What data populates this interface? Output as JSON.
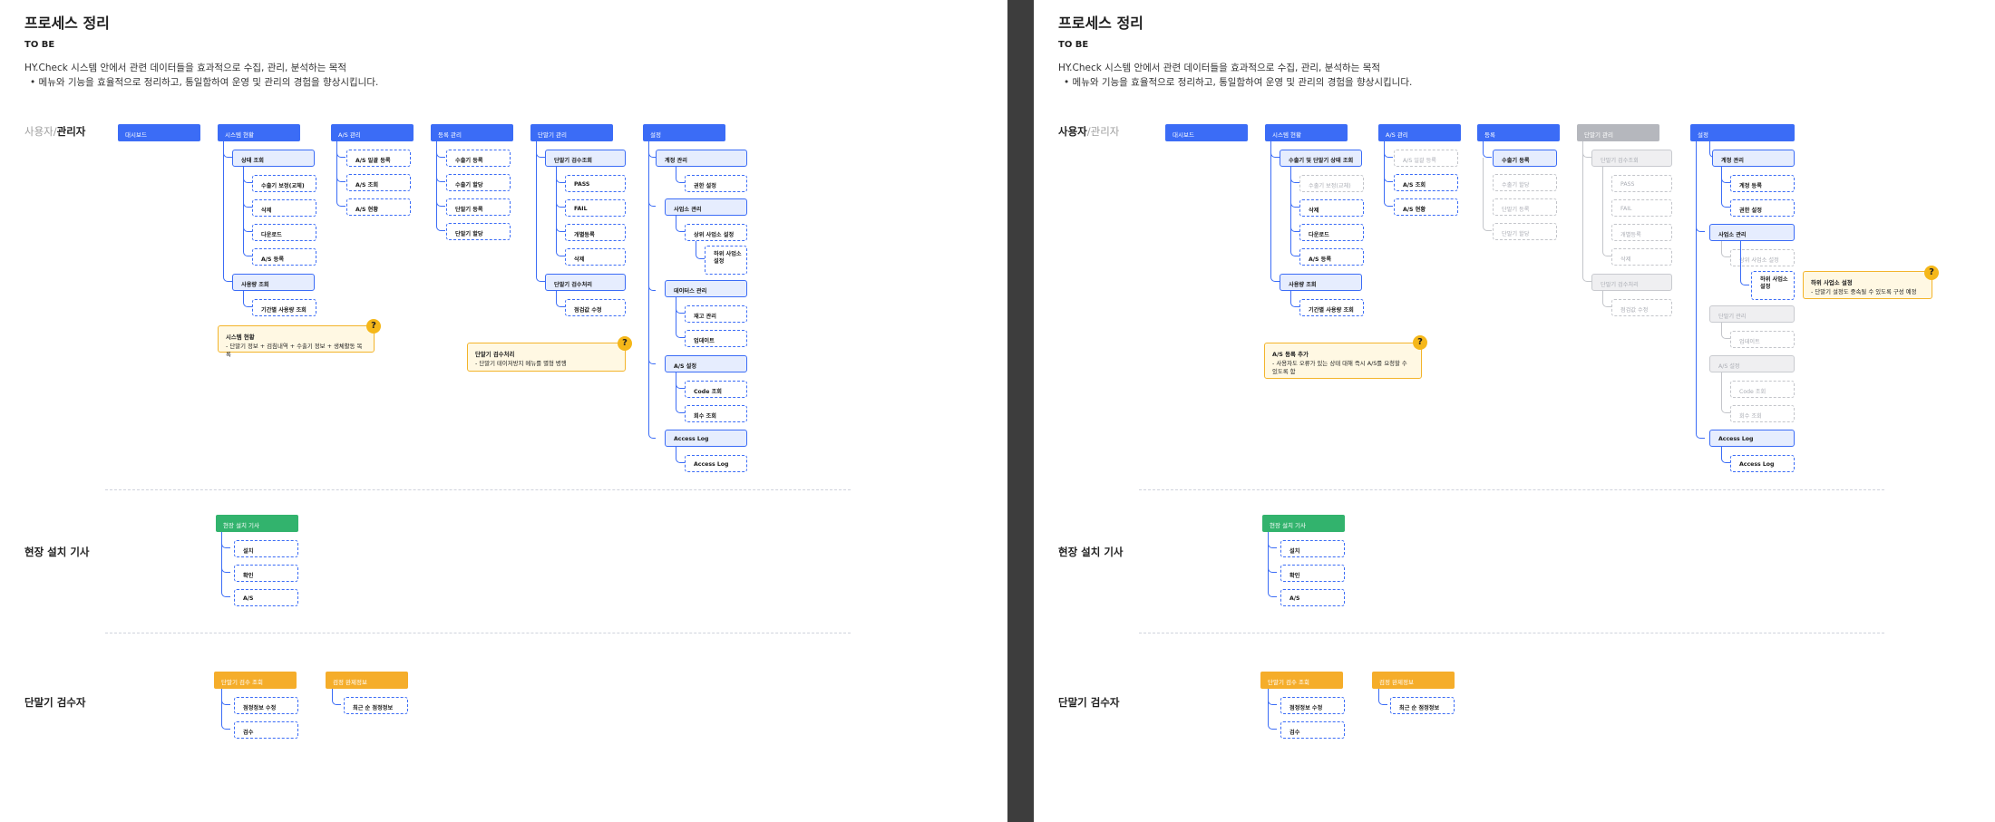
{
  "header": {
    "title": "프로세스 정리",
    "subtitle": "TO BE",
    "description": "HY.Check 시스템 안에서 관련 데이터들을 효과적으로 수집, 관리, 분석하는 목적",
    "bullet": "•  메뉴와 기능을 효율적으로 정리하고, 통일함하여 운영 및 관리의 경험을 향상시킵니다."
  },
  "left": {
    "sec1_a": "사용자/",
    "sec1_b": "관리자",
    "sec2": "현장 설치 기사",
    "sec3": "단말기 검수자",
    "roots": [
      "대시보드",
      "시스템 현황",
      "A/S 관리",
      "등록 관리",
      "단말기 관리",
      "설정"
    ],
    "sys": [
      "상태 조회",
      "수출기 보정(교체)",
      "삭제",
      "다운로드",
      "A/S 등록",
      "사용량 조회",
      "기간별 사용량 조회"
    ],
    "as": [
      "A/S 일괄 등록",
      "A/S 조회",
      "A/S 현황"
    ],
    "reg": [
      "수출기 등록",
      "수출기 할당",
      "단말기 등록",
      "단말기 할당"
    ],
    "term": [
      "단말기 검수조회",
      "PASS",
      "FAIL",
      "개별등록",
      "삭제",
      "단말기 검수처리",
      "점검값 수정"
    ],
    "set": [
      "계정 관리",
      "권한 설정",
      "사업소 관리",
      "상위 사업소 설정",
      "하위 사업소 설정",
      "데이터스 관리",
      "재고 관리",
      "업데이트",
      "A/S 설정",
      "Code 조회",
      "회수 조회",
      "Access Log",
      "Access Log"
    ],
    "note1_t": "시스템 현황",
    "note1_b": "- 단말기 정보 + 검침내역 + 수출기 정보 + 생체활동 목록",
    "note2_t": "단말기 검수처리",
    "note2_b": "- 단말기 테이저방지 메뉴를 별형 병행",
    "field_root": "현장 설치 기사",
    "field": [
      "설치",
      "확인",
      "A/S"
    ],
    "insp_root1": "단말기 검수 조회",
    "insp_root2": "검정 완제정보",
    "insp": [
      "점정정보 수정",
      "검수"
    ],
    "insp2": [
      "최근 순 점정정보"
    ]
  },
  "right": {
    "sec1_a": "사용자",
    "sec1_b": "/관리자",
    "sec2": "현장 설치 기사",
    "sec3": "단말기 검수자",
    "roots": [
      "대시보드",
      "시스템 현황",
      "A/S 관리",
      "등록",
      "단말기 관리",
      "설정"
    ],
    "sys": [
      "수출기 및 단말기 상태 조회",
      "수출기 보정(교체)",
      "삭제",
      "다운로드",
      "A/S 등록",
      "사용량 조회",
      "기간별 사용량 조회"
    ],
    "as": [
      "A/S 일괄 등록",
      "A/S 조회",
      "A/S 현황"
    ],
    "reg": [
      "수출기 등록",
      "수출기 할당",
      "단말기 등록",
      "단말기 할당"
    ],
    "term": [
      "단말기 검수조회",
      "PASS",
      "FAIL",
      "개별등록",
      "삭제",
      "단말기 검수처리",
      "점검값 수정"
    ],
    "set": [
      "계정 관리",
      "계정 등록",
      "권한 설정",
      "사업소 관리",
      "상위 사업소 설정",
      "하위 사업소 설정",
      "단말기 관리",
      "업데이트",
      "A/S 설정",
      "Code 조회",
      "회수 조회",
      "Access Log",
      "Access Log"
    ],
    "note1_t": "A/S 등록 추가",
    "note1_b": "- 사용자도 오류가 있는 상태 대해 즉시 A/S를 요청할 수 있도록 함",
    "note2_t": "하위 사업소 설정",
    "note2_b": "- 단말기 설정도 중속될 수 있도록 구성 예정",
    "field_root": "현장 설치 기사",
    "field": [
      "설치",
      "확인",
      "A/S"
    ],
    "insp_root1": "단말기 검수 조회",
    "insp_root2": "검정 완제정보",
    "insp": [
      "점정정보 수정",
      "검수"
    ],
    "insp2": [
      "최근 순 점정정보"
    ]
  },
  "colors": {
    "blue": "#3b6cf6",
    "green": "#32b36d",
    "orange": "#f5ad2a",
    "gray": "#b5b7bd",
    "note": "#fff8e3",
    "separator_bar": "#3d3d3d"
  },
  "icons": [
    "question-mark-icon"
  ]
}
